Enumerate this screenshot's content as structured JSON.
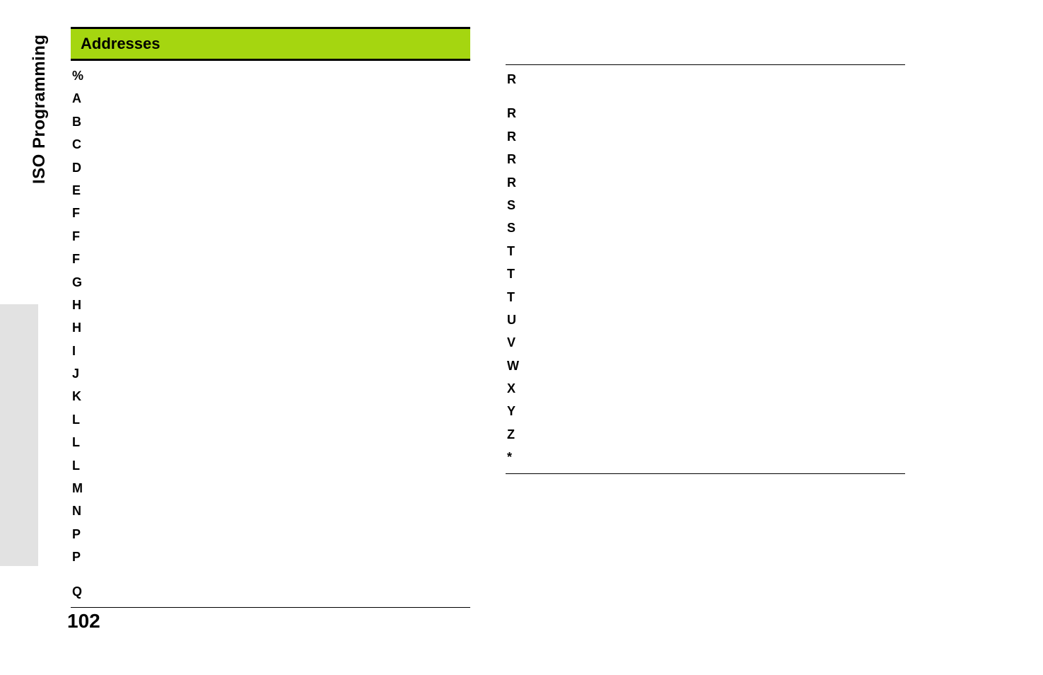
{
  "sideLabel": "ISO Programming",
  "pageNumber": "102",
  "header": "Addresses",
  "leftColumn": [
    "%",
    "A",
    "B",
    "C",
    "D",
    "E",
    "F",
    "F",
    "F",
    "G",
    "H",
    "H",
    "I",
    "J",
    "K",
    "L",
    "L",
    "L",
    "M",
    "N",
    "P",
    "P"
  ],
  "leftColumnLast": "Q",
  "rightColumn": [
    "R"
  ],
  "rightColumnRest": [
    "R",
    "R",
    "R",
    "R",
    "S",
    "S",
    "T",
    "T",
    "T",
    "U",
    "V",
    "W",
    "X",
    "Y",
    "Z",
    "*"
  ]
}
